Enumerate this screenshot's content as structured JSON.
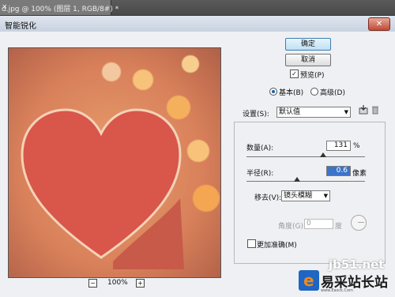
{
  "doc_tab": {
    "label": "d.jpg @ 100% (图层 1, RGB/8#) *",
    "close": "×"
  },
  "dialog": {
    "title": "智能锐化",
    "close": "✕"
  },
  "preview": {
    "zoom": "100%",
    "zoom_out": "−",
    "zoom_in": "+"
  },
  "buttons": {
    "ok": "确定",
    "cancel": "取消"
  },
  "preview_toggle": {
    "label": "预览(P)",
    "checked": true,
    "mark": "✓"
  },
  "mode": {
    "basic": "基本(B)",
    "advanced": "高级(D)",
    "selected": "basic"
  },
  "settings": {
    "label": "设置(S):",
    "value": "默认值"
  },
  "amount": {
    "label": "数量(A):",
    "value": "131",
    "unit": "%",
    "level": 0.66
  },
  "radius": {
    "label": "半径(R):",
    "value": "0.6",
    "unit": "像素",
    "level": 0.4
  },
  "remove": {
    "label": "移去(V):",
    "value": "镜头模糊"
  },
  "angle": {
    "label": "角度(G):",
    "value": "0",
    "unit": "度"
  },
  "more_accurate": {
    "label": "更加准确(M)",
    "checked": false
  },
  "watermark": {
    "url": "jb51.net",
    "name": "易采站长站",
    "sub": "www.Easck.Com"
  },
  "colors": {
    "accent": "#3d74c8",
    "dialog_bg": "#eef0f3",
    "heart": "#d84f45"
  }
}
